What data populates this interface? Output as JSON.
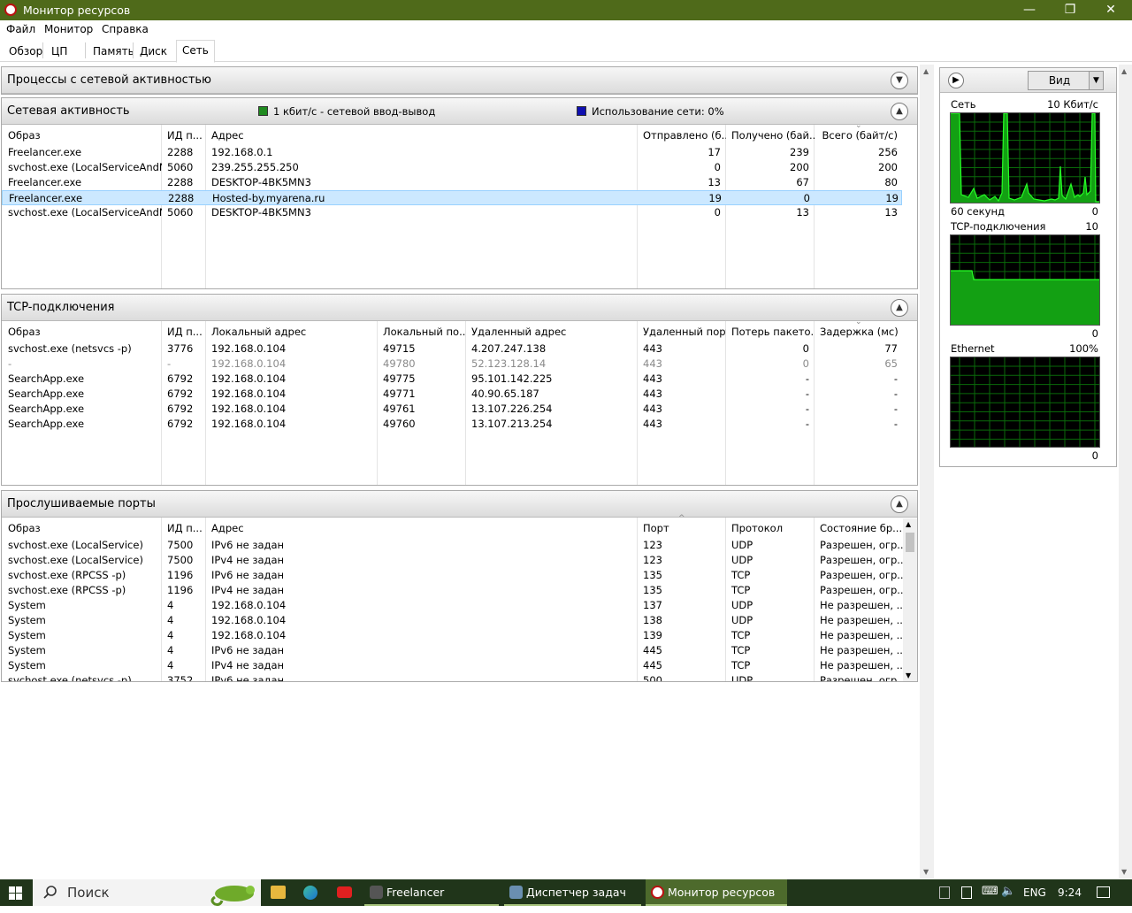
{
  "window": {
    "title": "Монитор ресурсов",
    "minimize_glyph": "—",
    "restore_glyph": "❐",
    "close_glyph": "✕"
  },
  "menu": [
    "Файл",
    "Монитор",
    "Справка"
  ],
  "tabs": [
    "Обзор",
    "ЦП",
    "Память",
    "Диск",
    "Сеть"
  ],
  "active_tab": "Сеть",
  "sections": {
    "processes": {
      "title": "Процессы с сетевой активностью",
      "state": "collapsed"
    },
    "activity": {
      "title": "Сетевая активность",
      "legend": [
        {
          "text": "1 кбит/с - сетевой ввод-вывод",
          "color": "#1f8a1f"
        },
        {
          "text": "Использование сети: 0%",
          "color": "#1010b0"
        }
      ],
      "columns": [
        "Образ",
        "ИД п...",
        "Адрес",
        "Отправлено (б...",
        "Получено (бай...",
        "Всего (байт/с)"
      ],
      "rows": [
        [
          "Freelancer.exe",
          "2288",
          "192.168.0.1",
          "17",
          "239",
          "256"
        ],
        [
          "svchost.exe (LocalServiceAndNo...",
          "5060",
          "239.255.255.250",
          "0",
          "200",
          "200"
        ],
        [
          "Freelancer.exe",
          "2288",
          "DESKTOP-4BK5MN3",
          "13",
          "67",
          "80"
        ],
        [
          "Freelancer.exe",
          "2288",
          "Hosted-by.myarena.ru",
          "19",
          "0",
          "19"
        ],
        [
          "svchost.exe (LocalServiceAndNo...",
          "5060",
          "DESKTOP-4BK5MN3",
          "0",
          "13",
          "13"
        ]
      ],
      "selected_row": 3
    },
    "tcp": {
      "title": "TCP-подключения",
      "columns": [
        "Образ",
        "ИД п...",
        "Локальный адрес",
        "Локальный по...",
        "Удаленный адрес",
        "Удаленный порт",
        "Потерь пакето...",
        "Задержка (мс)"
      ],
      "rows": [
        [
          "svchost.exe (netsvcs -p)",
          "3776",
          "192.168.0.104",
          "49715",
          "4.207.247.138",
          "443",
          "0",
          "77"
        ],
        [
          "-",
          "-",
          "192.168.0.104",
          "49780",
          "52.123.128.14",
          "443",
          "0",
          "65"
        ],
        [
          "SearchApp.exe",
          "6792",
          "192.168.0.104",
          "49775",
          "95.101.142.225",
          "443",
          "-",
          "-"
        ],
        [
          "SearchApp.exe",
          "6792",
          "192.168.0.104",
          "49771",
          "40.90.65.187",
          "443",
          "-",
          "-"
        ],
        [
          "SearchApp.exe",
          "6792",
          "192.168.0.104",
          "49761",
          "13.107.226.254",
          "443",
          "-",
          "-"
        ],
        [
          "SearchApp.exe",
          "6792",
          "192.168.0.104",
          "49760",
          "13.107.213.254",
          "443",
          "-",
          "-"
        ]
      ],
      "dim_row": 1
    },
    "ports": {
      "title": "Прослушиваемые порты",
      "columns": [
        "Образ",
        "ИД п...",
        "Адрес",
        "Порт",
        "Протокол",
        "Состояние бр..."
      ],
      "rows": [
        [
          "svchost.exe (LocalService)",
          "7500",
          "IPv6 не задан",
          "123",
          "UDP",
          "Разрешен, огр..."
        ],
        [
          "svchost.exe (LocalService)",
          "7500",
          "IPv4 не задан",
          "123",
          "UDP",
          "Разрешен, огр..."
        ],
        [
          "svchost.exe (RPCSS -p)",
          "1196",
          "IPv6 не задан",
          "135",
          "TCP",
          "Разрешен, огр..."
        ],
        [
          "svchost.exe (RPCSS -p)",
          "1196",
          "IPv4 не задан",
          "135",
          "TCP",
          "Разрешен, огр..."
        ],
        [
          "System",
          "4",
          "192.168.0.104",
          "137",
          "UDP",
          "Не разрешен, ..."
        ],
        [
          "System",
          "4",
          "192.168.0.104",
          "138",
          "UDP",
          "Не разрешен, ..."
        ],
        [
          "System",
          "4",
          "192.168.0.104",
          "139",
          "TCP",
          "Не разрешен, ..."
        ],
        [
          "System",
          "4",
          "IPv6 не задан",
          "445",
          "TCP",
          "Не разрешен, ..."
        ],
        [
          "System",
          "4",
          "IPv4 не задан",
          "445",
          "TCP",
          "Не разрешен, ..."
        ],
        [
          "svchost.exe (netsvcs -p)",
          "3752",
          "IPv6 не задан",
          "500",
          "UDP",
          "Разрешен, огр..."
        ]
      ]
    }
  },
  "right_panel": {
    "view_button": "Вид",
    "graphs": [
      {
        "name": "Сеть",
        "max": "10 Кбит/с",
        "footer_left": "60 секунд",
        "footer_right": "0"
      },
      {
        "name": "TCP-подключения",
        "max": "10",
        "footer_right": "0"
      },
      {
        "name": "Ethernet",
        "max": "100%",
        "footer_right": "0"
      }
    ],
    "colors": {
      "graph_bg": "#000000",
      "grid": "#0a6a0a",
      "line": "#1fcf1f",
      "fill": "#13a013"
    }
  },
  "taskbar": {
    "search_placeholder": "Поиск",
    "items": [
      {
        "label": "Freelancer",
        "active": false
      },
      {
        "label": "Диспетчер задач",
        "active": false
      },
      {
        "label": "Монитор ресурсов",
        "active": true
      }
    ],
    "lang": "ENG",
    "time": "9:24"
  }
}
